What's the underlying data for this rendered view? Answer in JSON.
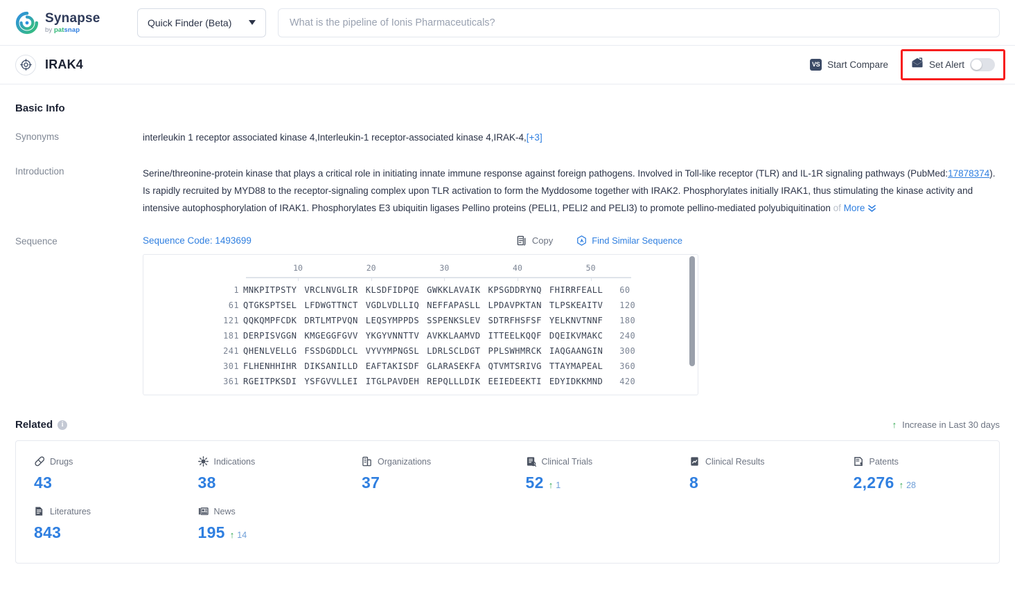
{
  "header": {
    "logo": {
      "name": "Synapse",
      "by": "by ",
      "pat": "pat",
      "snap": "snap",
      "icon": "synapse-swirl-icon"
    },
    "finder": {
      "label": "Quick Finder (Beta)",
      "icon": "chevron-down-icon"
    },
    "search": {
      "value": "",
      "placeholder": "What is the pipeline of Ionis Pharmaceuticals?"
    }
  },
  "entity": {
    "name": "IRAK4",
    "icon": "target-icon",
    "start_compare": {
      "label": "Start Compare",
      "icon": "vs-icon",
      "badge": "VS"
    },
    "set_alert": {
      "label": "Set Alert",
      "icon": "alert-mail-icon",
      "toggle_state": "off",
      "highlight_color": "#f71e1e"
    }
  },
  "basic_info": {
    "title": "Basic Info",
    "synonyms": {
      "label": "Synonyms",
      "value": "interleukin 1 receptor associated kinase 4,Interleukin-1 receptor-associated kinase 4,IRAK-4,",
      "more_link": "[+3]"
    },
    "introduction": {
      "label": "Introduction",
      "part1": "Serine/threonine-protein kinase that plays a critical role in initiating innate immune response against foreign pathogens. Involved in Toll-like receptor (TLR) and IL-1R signaling pathways (PubMed:",
      "pubmed_id": "17878374",
      "part2": "). Is rapidly recruited by MYD88 to the receptor-signaling complex upon TLR activation to form the Myddosome together with IRAK2. Phosphorylates initially IRAK1, thus stimulating the kinase activity and intensive autophosphorylation of IRAK1. Phosphorylates E3 ubiquitin ligases Pellino proteins (PELI1, PELI2 and PELI3) to promote pellino-mediated polyubiquitination",
      "faded_tail": " of",
      "more_label": "More",
      "more_icon": "chevron-double-down-icon"
    },
    "sequence": {
      "label": "Sequence",
      "code_label": "Sequence Code: 1493699",
      "copy_label": "Copy",
      "copy_icon": "copy-icon",
      "find_label": "Find Similar Sequence",
      "find_icon": "find-similar-icon",
      "ruler_ticks": [
        "10",
        "20",
        "30",
        "40",
        "50"
      ],
      "lines": [
        {
          "start": "1",
          "chunks": [
            "MNKPITPSTY",
            "VRCLNVGLIR",
            "KLSDFIDPQE",
            "GWKKLAVAIK",
            "KPSGDDRYNQ",
            "FHIRRFEALL"
          ],
          "end": "60"
        },
        {
          "start": "61",
          "chunks": [
            "QTGKSPTSEL",
            "LFDWGTTNCT",
            "VGDLVDLLIQ",
            "NEFFAPASLL",
            "LPDAVPKTAN",
            "TLPSKEAITV"
          ],
          "end": "120"
        },
        {
          "start": "121",
          "chunks": [
            "QQKQMPFCDK",
            "DRTLMTPVQN",
            "LEQSYMPPDS",
            "SSPENKSLEV",
            "SDTRFHSFSF",
            "YELKNVTNNF"
          ],
          "end": "180"
        },
        {
          "start": "181",
          "chunks": [
            "DERPISVGGN",
            "KMGEGGFGVV",
            "YKGYVNNTTV",
            "AVKKLAAMVD",
            "ITTEELKQQF",
            "DQEIKVMAKC"
          ],
          "end": "240"
        },
        {
          "start": "241",
          "chunks": [
            "QHENLVELLG",
            "FSSDGDDLCL",
            "VYVYMPNGSL",
            "LDRLSCLDGT",
            "PPLSWHMRCK",
            "IAQGAANGIN"
          ],
          "end": "300"
        },
        {
          "start": "301",
          "chunks": [
            "FLHENHHIHR",
            "DIKSANILLD",
            "EAFTAKISDF",
            "GLARASEKFA",
            "QTVMTSRIVG",
            "TTAYMAPEAL"
          ],
          "end": "360"
        },
        {
          "start": "361",
          "chunks": [
            "RGEITPKSDI",
            "YSFGVVLLEI",
            "ITGLPAVDEH",
            "REPQLLLDIK",
            "EEIEDEEKTI",
            "EDYIDKKMND"
          ],
          "end": "420"
        }
      ]
    }
  },
  "related": {
    "title": "Related",
    "info_icon": "info-icon",
    "legend": {
      "label": "Increase in Last 30 days",
      "arrow": "↑"
    },
    "stats": [
      {
        "label": "Drugs",
        "icon": "capsule-icon",
        "value": "43",
        "delta": ""
      },
      {
        "label": "Indications",
        "icon": "virus-icon",
        "value": "38",
        "delta": ""
      },
      {
        "label": "Organizations",
        "icon": "building-icon",
        "value": "37",
        "delta": ""
      },
      {
        "label": "Clinical Trials",
        "icon": "clinical-trial-icon",
        "value": "52",
        "delta": "1"
      },
      {
        "label": "Clinical Results",
        "icon": "clinical-result-icon",
        "value": "8",
        "delta": ""
      },
      {
        "label": "Patents",
        "icon": "patent-icon",
        "value": "2,276",
        "delta": "28"
      },
      {
        "label": "Literatures",
        "icon": "literature-icon",
        "value": "843",
        "delta": ""
      },
      {
        "label": "News",
        "icon": "news-icon",
        "value": "195",
        "delta": "14"
      }
    ]
  },
  "colors": {
    "accent": "#2f7fe0",
    "increase": "#33a852",
    "alert_highlight": "#f71e1e",
    "logo_navy": "#2e3a59"
  }
}
